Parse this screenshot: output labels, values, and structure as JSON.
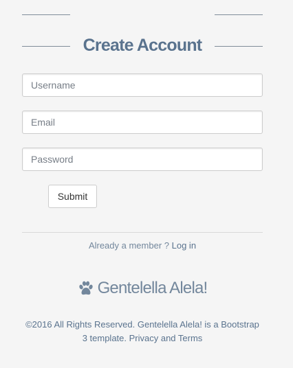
{
  "form": {
    "title": "Create Account",
    "username_placeholder": "Username",
    "email_placeholder": "Email",
    "password_placeholder": "Password",
    "submit_label": "Submit"
  },
  "switch": {
    "prompt": "Already a member ?",
    "login_link": "Log in"
  },
  "brand": {
    "icon": "paw-icon",
    "name": "Gentelella Alela!"
  },
  "footer": {
    "text": "©2016 All Rights Reserved. Gentelella Alela! is a Bootstrap 3 template. Privacy and Terms"
  }
}
